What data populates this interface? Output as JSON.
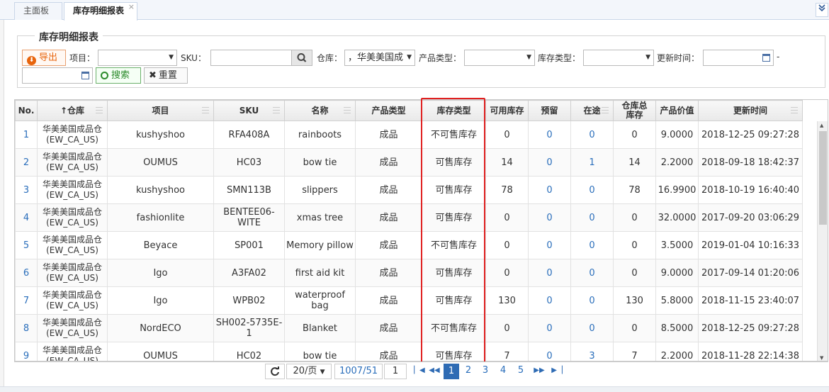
{
  "tabs": [
    {
      "label": "主面板"
    },
    {
      "label": "库存明细报表",
      "close": "×"
    }
  ],
  "tab_menu_icon": "chevron-double-down-icon",
  "filter": {
    "legend": "库存明细报表",
    "export_label": "导出",
    "project_label": "项目：",
    "project_value": "",
    "sku_label": "SKU：",
    "sku_value": "",
    "warehouse_label": "仓库：",
    "warehouse_value": "，华美美国成",
    "product_type_label": "产品类型：",
    "product_type_value": "",
    "stock_type_label": "库存类型：",
    "stock_type_value": "",
    "update_time_label": "更新时间：",
    "update_time_from": "",
    "range_sep": "-",
    "update_time_to": "",
    "search_label": "搜索",
    "reset_label": "重置"
  },
  "table": {
    "columns": [
      "No.",
      "仓库",
      "项目",
      "SKU",
      "名称",
      "产品类型",
      "库存类型",
      "可用库存",
      "预留",
      "在途",
      "仓库总库存",
      "产品价值",
      "更新时间"
    ],
    "sort_indicator": "↑",
    "rows": [
      {
        "no": "1",
        "warehouse": "华美美国成品仓(EW_CA_US)",
        "project": "kushyshoo",
        "sku": "RFA408A",
        "name": "rainboots",
        "ptype": "成品",
        "stype": "不可售库存",
        "avail": "0",
        "reserved": "0",
        "transit": "0",
        "total": "0",
        "value": "9.0000",
        "updated": "2018-12-25 09:27:28"
      },
      {
        "no": "2",
        "warehouse": "华美美国成品仓(EW_CA_US)",
        "project": "OUMUS",
        "sku": "HC03",
        "name": "bow tie",
        "ptype": "成品",
        "stype": "可售库存",
        "avail": "14",
        "reserved": "0",
        "transit": "1",
        "total": "14",
        "value": "2.2000",
        "updated": "2018-09-18 18:42:37"
      },
      {
        "no": "3",
        "warehouse": "华美美国成品仓(EW_CA_US)",
        "project": "kushyshoo",
        "sku": "SMN113B",
        "name": "slippers",
        "ptype": "成品",
        "stype": "可售库存",
        "avail": "78",
        "reserved": "0",
        "transit": "0",
        "total": "78",
        "value": "16.9900",
        "updated": "2018-10-19 16:40:40"
      },
      {
        "no": "4",
        "warehouse": "华美美国成品仓(EW_CA_US)",
        "project": "fashionlite",
        "sku": "BENTEE06-WITE",
        "name": "xmas tree",
        "ptype": "成品",
        "stype": "可售库存",
        "avail": "0",
        "reserved": "0",
        "transit": "0",
        "total": "0",
        "value": "32.0000",
        "updated": "2017-09-20 03:06:29"
      },
      {
        "no": "5",
        "warehouse": "华美美国成品仓(EW_CA_US)",
        "project": "Beyace",
        "sku": "SP001",
        "name": "Memory pillow",
        "ptype": "成品",
        "stype": "不可售库存",
        "avail": "0",
        "reserved": "0",
        "transit": "0",
        "total": "0",
        "value": "3.5000",
        "updated": "2019-01-04 10:16:33"
      },
      {
        "no": "6",
        "warehouse": "华美美国成品仓(EW_CA_US)",
        "project": "Igo",
        "sku": "A3FA02",
        "name": "first aid kit",
        "ptype": "成品",
        "stype": "可售库存",
        "avail": "0",
        "reserved": "0",
        "transit": "0",
        "total": "0",
        "value": "9.0000",
        "updated": "2017-09-14 01:20:06"
      },
      {
        "no": "7",
        "warehouse": "华美美国成品仓(EW_CA_US)",
        "project": "Igo",
        "sku": "WPB02",
        "name": "waterproof bag",
        "ptype": "成品",
        "stype": "可售库存",
        "avail": "130",
        "reserved": "0",
        "transit": "0",
        "total": "130",
        "value": "5.8000",
        "updated": "2018-11-15 23:40:07"
      },
      {
        "no": "8",
        "warehouse": "华美美国成品仓(EW_CA_US)",
        "project": "NordECO",
        "sku": "SH002-5735E-1",
        "name": "Blanket",
        "ptype": "成品",
        "stype": "不可售库存",
        "avail": "0",
        "reserved": "0",
        "transit": "0",
        "total": "0",
        "value": "8.5000",
        "updated": "2018-12-25 09:27:28"
      },
      {
        "no": "9",
        "warehouse": "华美美国成品仓(EW_CA_US)",
        "project": "OUMUS",
        "sku": "HC02",
        "name": "bow tie",
        "ptype": "成品",
        "stype": "可售库存",
        "avail": "7",
        "reserved": "0",
        "transit": "3",
        "total": "7",
        "value": "2.2000",
        "updated": "2018-11-28 22:14:38"
      }
    ]
  },
  "pager": {
    "page_size": "20/页",
    "total": "1007/51",
    "current_input": "1",
    "pages": [
      "1",
      "2",
      "3",
      "4",
      "5"
    ],
    "active_page": "1"
  },
  "colors": {
    "highlight": "#e02020",
    "link": "#2a6ebb",
    "export": "#e8640c",
    "search": "#2a8a2a",
    "active_page": "#2e6bb4"
  }
}
